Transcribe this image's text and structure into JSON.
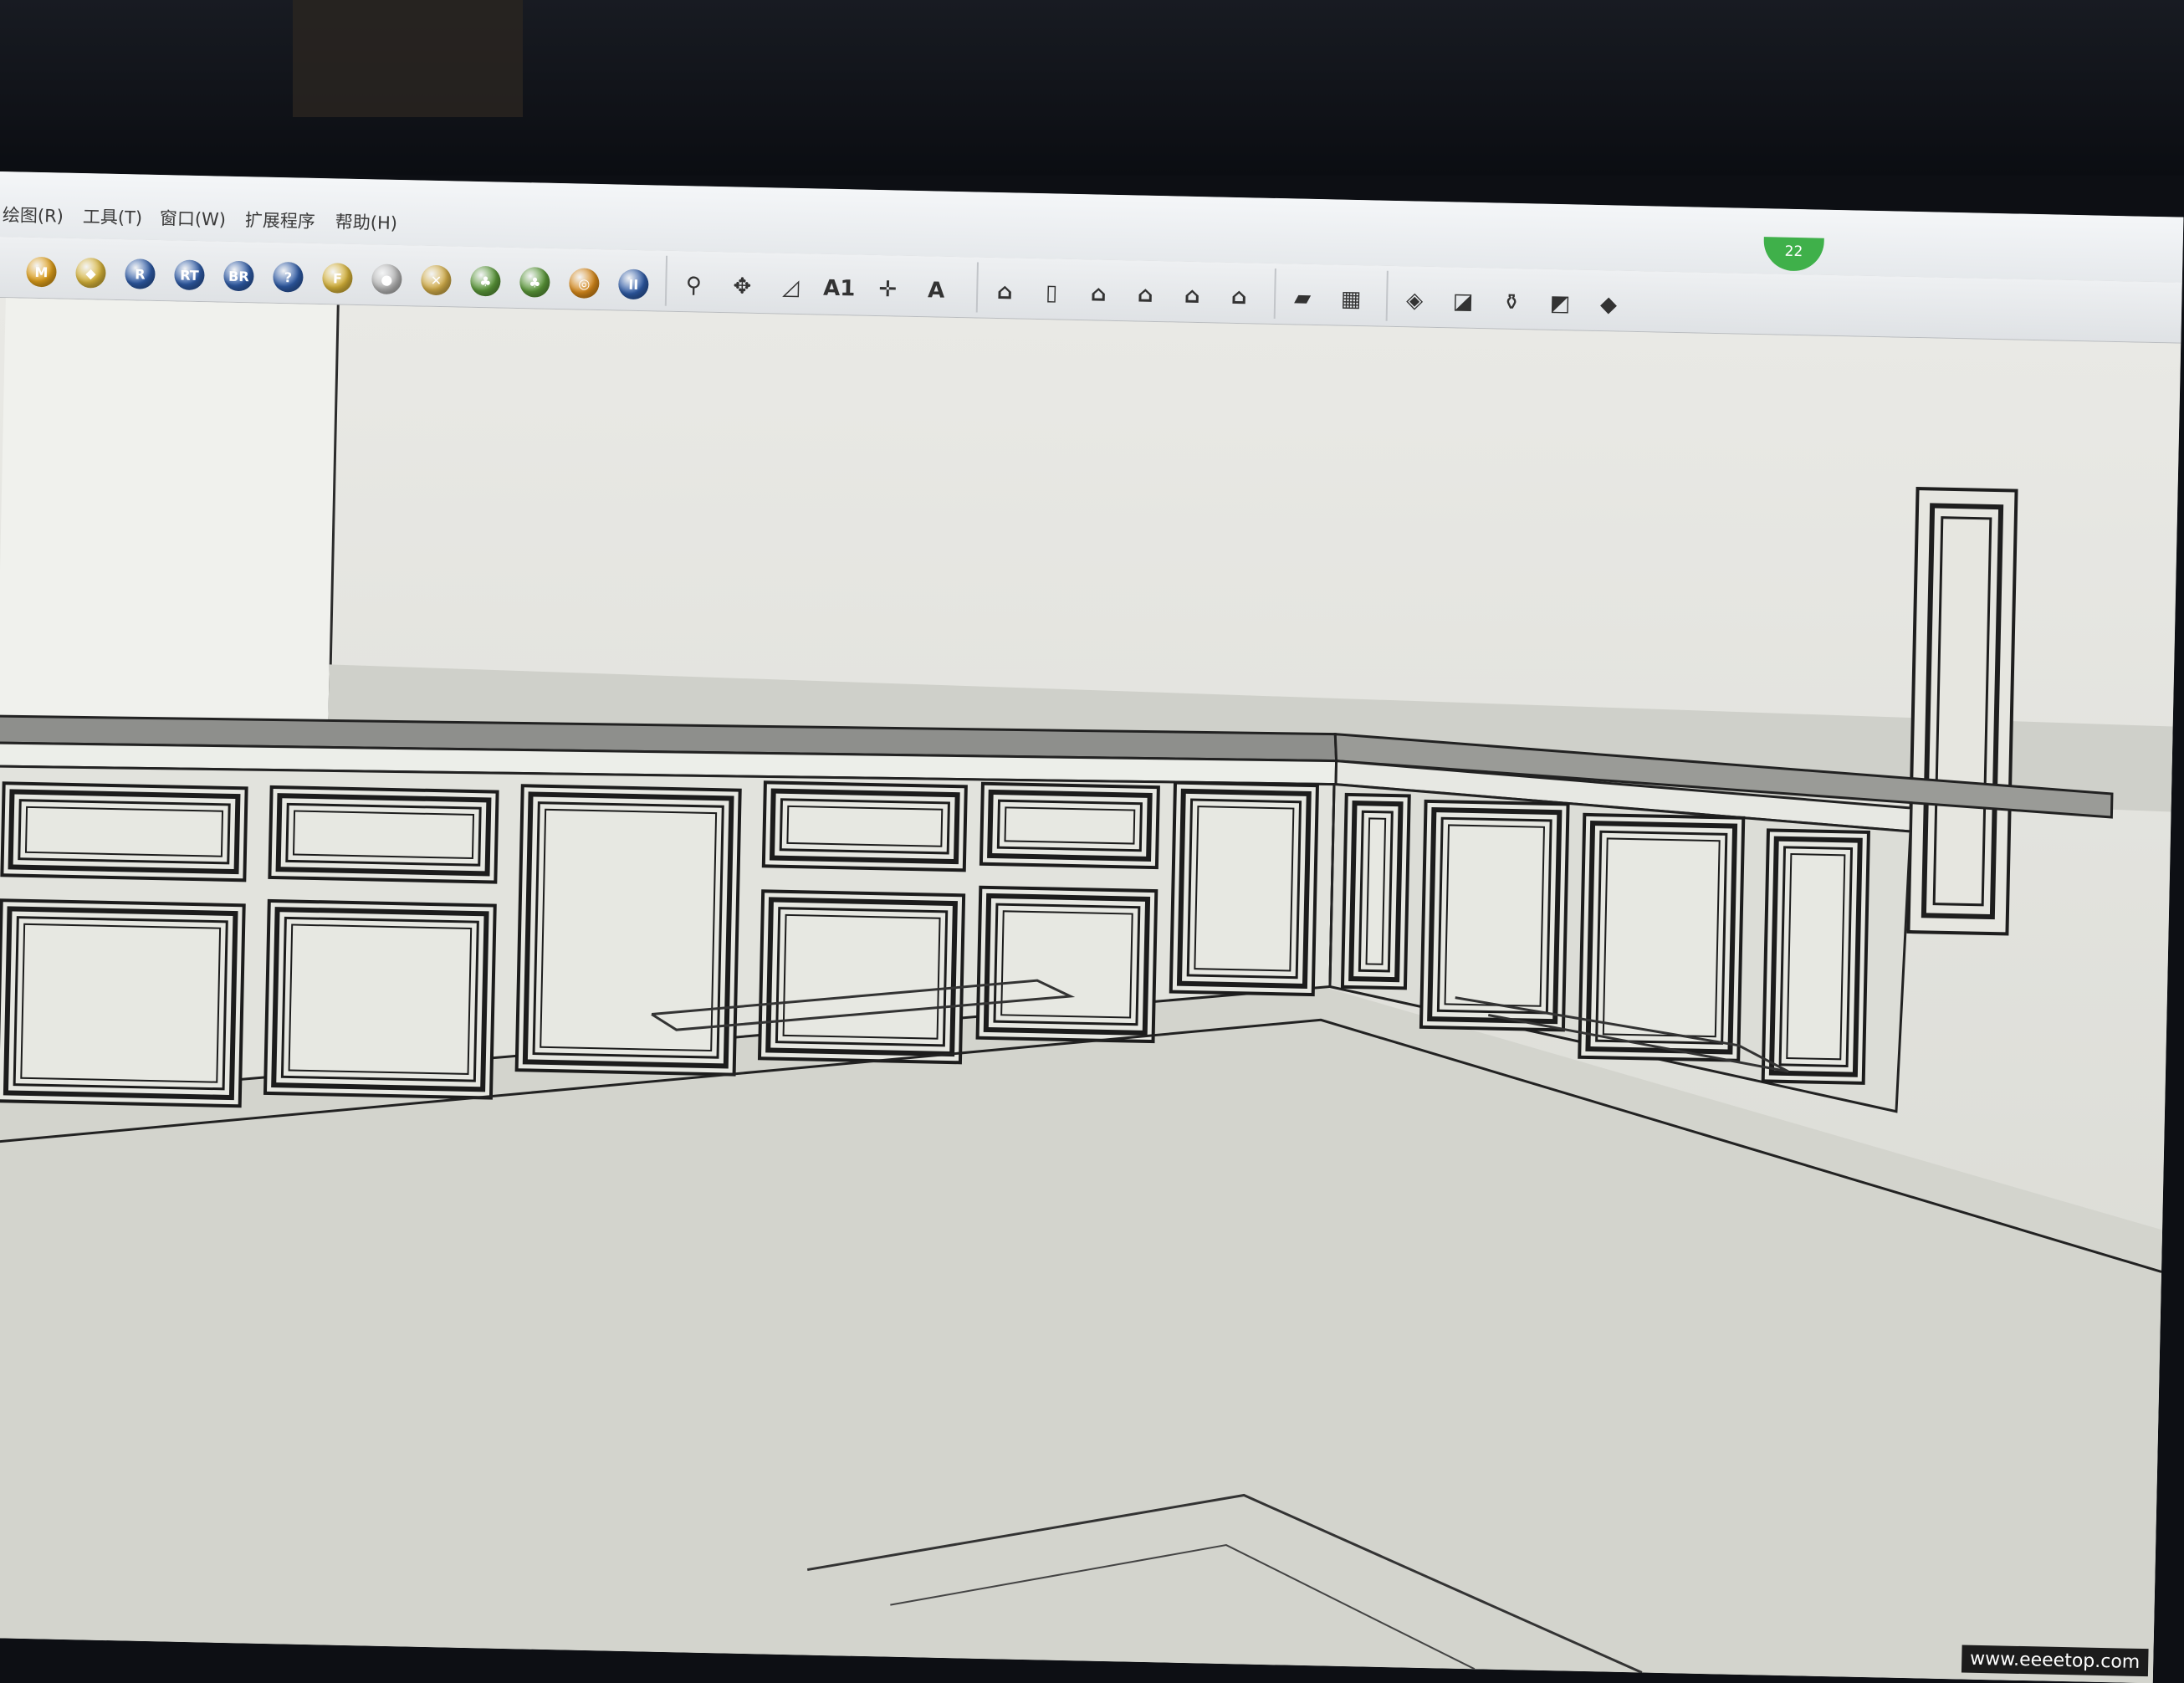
{
  "menubar": {
    "items": [
      {
        "label": "绘图(R)"
      },
      {
        "label": "工具(T)"
      },
      {
        "label": "窗口(W)"
      },
      {
        "label": "扩展程序"
      },
      {
        "label": "帮助(H)"
      }
    ],
    "notification_count": "22"
  },
  "toolbar": {
    "render_group": [
      {
        "icon": "material-editor-icon",
        "glyph": "M",
        "color": "#e2a11b"
      },
      {
        "icon": "light-tag-icon",
        "glyph": "◆",
        "color": "#d9b53a"
      },
      {
        "icon": "render-icon",
        "glyph": "R",
        "color": "#2f5ca8"
      },
      {
        "icon": "render-region-icon",
        "glyph": "RT",
        "color": "#2f5ca8"
      },
      {
        "icon": "batch-render-icon",
        "glyph": "BR",
        "color": "#2f5ca8"
      },
      {
        "icon": "help-icon",
        "glyph": "?",
        "color": "#2f5ca8"
      },
      {
        "icon": "frame-buffer-icon",
        "glyph": "F",
        "color": "#d9b53a"
      },
      {
        "icon": "sphere-light-icon",
        "glyph": "●",
        "color": "#b9b9b9"
      },
      {
        "icon": "plane-light-icon",
        "glyph": "✕",
        "color": "#d6b04a"
      },
      {
        "icon": "proxy-tree-icon",
        "glyph": "♣",
        "color": "#5c9a3a"
      },
      {
        "icon": "proxy-export-icon",
        "glyph": "♣",
        "color": "#5c9a3a"
      },
      {
        "icon": "target-icon",
        "glyph": "◎",
        "color": "#d98a1a"
      },
      {
        "icon": "pause-icon",
        "glyph": "II",
        "color": "#2f5ca8"
      }
    ],
    "construction_group": [
      {
        "icon": "tape-measure-icon",
        "glyph": "⚲"
      },
      {
        "icon": "dimension-icon",
        "glyph": "✥"
      },
      {
        "icon": "protractor-icon",
        "glyph": "◿"
      },
      {
        "icon": "text-tool-icon",
        "glyph": "A1"
      },
      {
        "icon": "axes-icon",
        "glyph": "✛"
      },
      {
        "icon": "3d-text-icon",
        "glyph": "A"
      }
    ],
    "views_group": [
      {
        "icon": "iso-view-icon",
        "glyph": "⌂"
      },
      {
        "icon": "top-view-icon",
        "glyph": "▯"
      },
      {
        "icon": "front-view-icon",
        "glyph": "⌂"
      },
      {
        "icon": "right-view-icon",
        "glyph": "⌂"
      },
      {
        "icon": "back-view-icon",
        "glyph": "⌂"
      },
      {
        "icon": "left-view-icon",
        "glyph": "⌂"
      }
    ],
    "sandbox_group_a": [
      {
        "icon": "sandbox-contours-icon",
        "glyph": "▰"
      },
      {
        "icon": "sandbox-scratch-icon",
        "glyph": "▦"
      }
    ],
    "sandbox_group_b": [
      {
        "icon": "smoove-icon",
        "glyph": "◈"
      },
      {
        "icon": "stamp-icon",
        "glyph": "◪"
      },
      {
        "icon": "drape-icon",
        "glyph": "⚱"
      },
      {
        "icon": "add-detail-icon",
        "glyph": "◩"
      },
      {
        "icon": "flip-edge-icon",
        "glyph": "◆"
      }
    ]
  },
  "colors": {
    "menubar_bg": "#eceef0",
    "viewport_bg": "#e4e4df",
    "edge": "#222222",
    "countertop": "#8e8f8c",
    "badge": "#3fb04a"
  },
  "watermark": "www.eeeetop.com"
}
